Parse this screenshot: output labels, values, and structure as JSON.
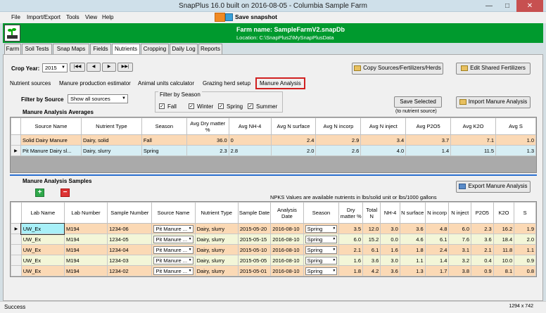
{
  "window": {
    "title": "SnapPlus 16.0 built on 2016-08-05 - Columbia Sample Farm",
    "min": "—",
    "max": "□",
    "close": "✕"
  },
  "menu": {
    "items": [
      "File",
      "Import/Export",
      "Tools",
      "View",
      "Help"
    ],
    "snapshot": "Save snapshot"
  },
  "farm": {
    "name": "Farm name: SampleFarmV2.snapDb",
    "location": "Location: C:\\SnapPlus2\\MySnapPlusData"
  },
  "tabs": [
    "Farm",
    "Soil Tests",
    "Snap Maps",
    "Fields",
    "Nutrients",
    "Cropping",
    "Daily Log",
    "Reports"
  ],
  "crop_year": {
    "label": "Crop Year:",
    "value": "2015"
  },
  "nav": {
    "first": "|◀◀",
    "prev": "◀",
    "next": "▶",
    "last": "▶▶|"
  },
  "buttons": {
    "copy": "Copy Sources/Fertilizers/Herds",
    "edit_fert": "Edit Shared Fertilizers",
    "save_selected": "Save Selected",
    "save_sub": "(to nutrient source)",
    "import": "Import Manure Analysis",
    "export": "Export Manure Analysis"
  },
  "subtabs": [
    "Nutrient sources",
    "Manure production estimator",
    "Animal units calculator",
    "Grazing herd setup",
    "Manure Analysis"
  ],
  "filter_source": {
    "label": "Filter by Source",
    "value": "Show all sources"
  },
  "filter_season": {
    "label": "Filter by Season",
    "fall": "Fall",
    "winter": "Winter",
    "spring": "Spring",
    "summer": "Summer"
  },
  "avg_section": "Manure Analysis Averages",
  "avg_table": {
    "headers": [
      "Source Name",
      "Nutrient Type",
      "Season",
      "Avg Dry matter %",
      "Avg NH-4",
      "Avg N surface",
      "Avg N incorp",
      "Avg N inject",
      "Avg P2O5",
      "Avg K2O",
      "Avg S"
    ],
    "rows": [
      [
        "Solid Dairy Manure",
        "Dairy, solid",
        "Fall",
        "36.0",
        "0",
        "2.4",
        "2.9",
        "3.4",
        "3.7",
        "7.1",
        "1.0"
      ],
      [
        "Pit Manure Dairy sl...",
        "Dairy, slurry",
        "Spring",
        "2.3",
        "2.8",
        "2.0",
        "2.6",
        "4.0",
        "1.4",
        "11.5",
        "1.3"
      ]
    ]
  },
  "samp_section": "Manure Analysis Samples",
  "npks_note": "NPKS Values are available nutrients in lbs/solid unit  or  lbs/1000 gallons",
  "samp_table": {
    "headers": [
      "Lab Name",
      "Lab Number",
      "Sample Number",
      "Source Name",
      "Nutrient Type",
      "Sample Date",
      "Analysis Date",
      "Season",
      "Dry matter %",
      "Total N",
      "NH-4",
      "N surface",
      "N incorp",
      "N inject",
      "P2O5",
      "K2O",
      "S"
    ],
    "rows": [
      [
        "UW_Ex",
        "M194",
        "1234-06",
        "Pit Manure ...",
        "Dairy, slurry",
        "2015-05-20",
        "2016-08-10",
        "Spring",
        "3.5",
        "12.0",
        "3.0",
        "3.6",
        "4.8",
        "6.0",
        "2.3",
        "16.2",
        "1.9"
      ],
      [
        "UW_Ex",
        "M194",
        "1234-05",
        "Pit Manure ...",
        "Dairy, slurry",
        "2015-05-15",
        "2016-08-10",
        "Spring",
        "6.0",
        "15.2",
        "0.0",
        "4.6",
        "6.1",
        "7.6",
        "3.6",
        "18.4",
        "2.0"
      ],
      [
        "UW_Ex",
        "M194",
        "1234-04",
        "Pit Manure ...",
        "Dairy, slurry",
        "2015-05-10",
        "2016-08-10",
        "Spring",
        "2.1",
        "6.1",
        "1.6",
        "1.8",
        "2.4",
        "3.1",
        "2.1",
        "11.8",
        "1.1"
      ],
      [
        "UW_Ex",
        "M194",
        "1234-03",
        "Pit Manure ...",
        "Dairy, slurry",
        "2015-05-05",
        "2016-08-10",
        "Spring",
        "1.6",
        "3.6",
        "3.0",
        "1.1",
        "1.4",
        "3.2",
        "0.4",
        "10.0",
        "0.9"
      ],
      [
        "UW_Ex",
        "M194",
        "1234-02",
        "Pit Manure ...",
        "Dairy, slurry",
        "2015-05-01",
        "2016-08-10",
        "Spring",
        "1.8",
        "4.2",
        "3.6",
        "1.3",
        "1.7",
        "3.8",
        "0.9",
        "8.1",
        "0.8"
      ]
    ]
  },
  "status": {
    "text": "Success",
    "size": "1294 x 742"
  },
  "colors": {
    "green_header": "#009a2e",
    "row_orange": "#fbd9b5",
    "row_cream": "#f3f6d8",
    "row_blue": "#d7eef4",
    "selected_cell": "#a8f0f8"
  }
}
